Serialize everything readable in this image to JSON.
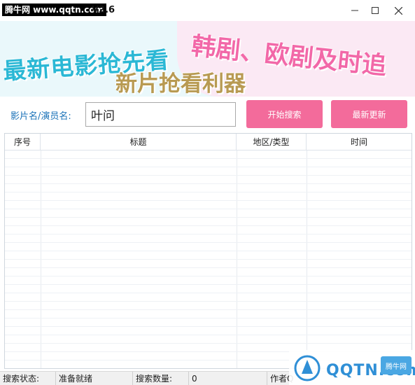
{
  "titlebar": {
    "watermark": "腾牛网 www.qqtn.com",
    "version": "V2.6"
  },
  "banner": {
    "line1": "最新电影抢先看",
    "line2": "韩剧、欧剧及时追",
    "line3": "新片抢看利器"
  },
  "search": {
    "label": "影片名/演员名:",
    "value": "叶问",
    "start_button": "开始搜索",
    "update_button": "最新更新"
  },
  "table": {
    "columns": [
      "序号",
      "标题",
      "地区/类型",
      "时间"
    ],
    "rows": []
  },
  "statusbar": {
    "status_label": "搜索状态:",
    "status_value": "准备就绪",
    "count_label": "搜索数量:",
    "count_value": "0",
    "author": "作者Q"
  },
  "corner_logo": {
    "text": "QQTN.com",
    "badge": "腾牛网"
  },
  "colors": {
    "accent_pink": "#f36b9b",
    "label_blue": "#1a72b8",
    "banner_cyan": "#2bb8d5",
    "banner_pink": "#f268a8",
    "banner_gold": "#b89a52"
  }
}
